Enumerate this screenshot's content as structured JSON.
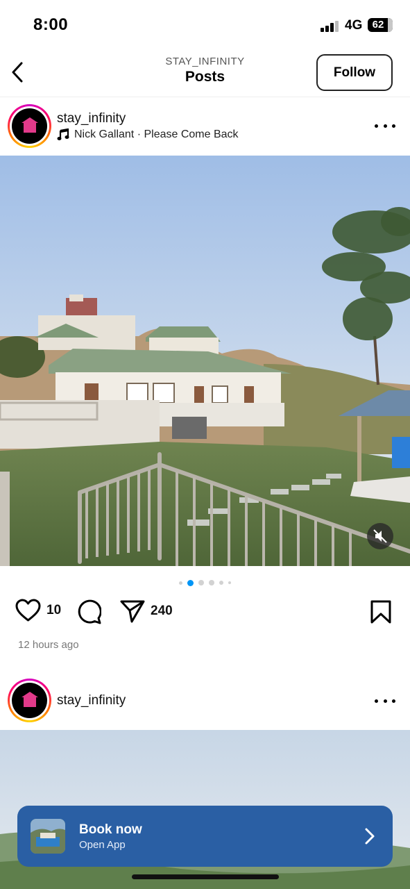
{
  "status_bar": {
    "time": "8:00",
    "network": "4G",
    "battery": "62"
  },
  "nav": {
    "back_icon": "chevron-left-icon",
    "overline": "STAY_INFINITY",
    "title": "Posts",
    "follow_label": "Follow"
  },
  "post": {
    "username": "stay_infinity",
    "music_icon": "music-note-icon",
    "audio": "Nick Gallant · Please Come Back",
    "more_icon": "more-horizontal-icon",
    "image_description_icon": "photo",
    "mute_icon": "speaker-muted-icon",
    "carousel_total": 6,
    "carousel_active": 2,
    "like_icon": "heart-icon",
    "likes": "10",
    "comment_icon": "comment-icon",
    "share_icon": "send-icon",
    "shares": "240",
    "save_icon": "bookmark-icon",
    "timestamp": "12 hours ago"
  },
  "next_post": {
    "username": "stay_infinity",
    "more_icon": "more-horizontal-icon"
  },
  "banner": {
    "title": "Book now",
    "subtitle": "Open App",
    "chevron_icon": "chevron-right-icon"
  },
  "colors": {
    "banner": "#2a5fa4",
    "active_dot": "#0095f6",
    "inactive_dot": "#d2d2d2"
  }
}
